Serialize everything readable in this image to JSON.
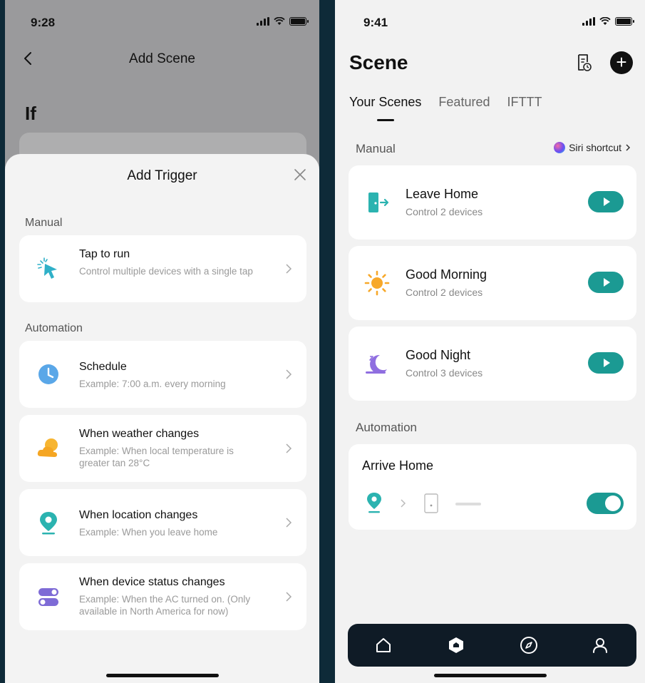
{
  "left": {
    "status_time": "9:28",
    "nav_title": "Add Scene",
    "if_label": "If",
    "sheet": {
      "title": "Add Trigger",
      "manual_label": "Manual",
      "automation_label": "Automation",
      "triggers": [
        {
          "title": "Tap to run",
          "desc": "Control multiple devices with a single tap",
          "icon": "tap-cursor-icon"
        },
        {
          "title": "Schedule",
          "desc": "Example: 7:00 a.m. every morning",
          "icon": "clock-icon"
        },
        {
          "title": "When weather changes",
          "desc": "Example: When local temperature is greater tan 28°C",
          "icon": "weather-icon"
        },
        {
          "title": "When location changes",
          "desc": "Example: When you leave home",
          "icon": "location-pin-icon"
        },
        {
          "title": "When device status changes",
          "desc": "Example: When the AC turned on. (Only available in North America for now)",
          "icon": "device-toggle-icon"
        }
      ]
    }
  },
  "right": {
    "status_time": "9:41",
    "title": "Scene",
    "tabs": [
      "Your Scenes",
      "Featured",
      "IFTTT"
    ],
    "manual_label": "Manual",
    "siri_label": "Siri shortcut",
    "scenes": [
      {
        "name": "Leave Home",
        "sub": "Control 2 devices",
        "icon": "door-exit-icon"
      },
      {
        "name": "Good Morning",
        "sub": "Control 2 devices",
        "icon": "sun-icon"
      },
      {
        "name": "Good Night",
        "sub": "Control 3 devices",
        "icon": "moon-icon"
      }
    ],
    "automation_label": "Automation",
    "automation": {
      "name": "Arrive Home",
      "enabled": true
    },
    "accent": "#1b9a93",
    "tabbar": [
      "home-icon",
      "scene-icon",
      "explore-icon",
      "profile-icon"
    ]
  }
}
